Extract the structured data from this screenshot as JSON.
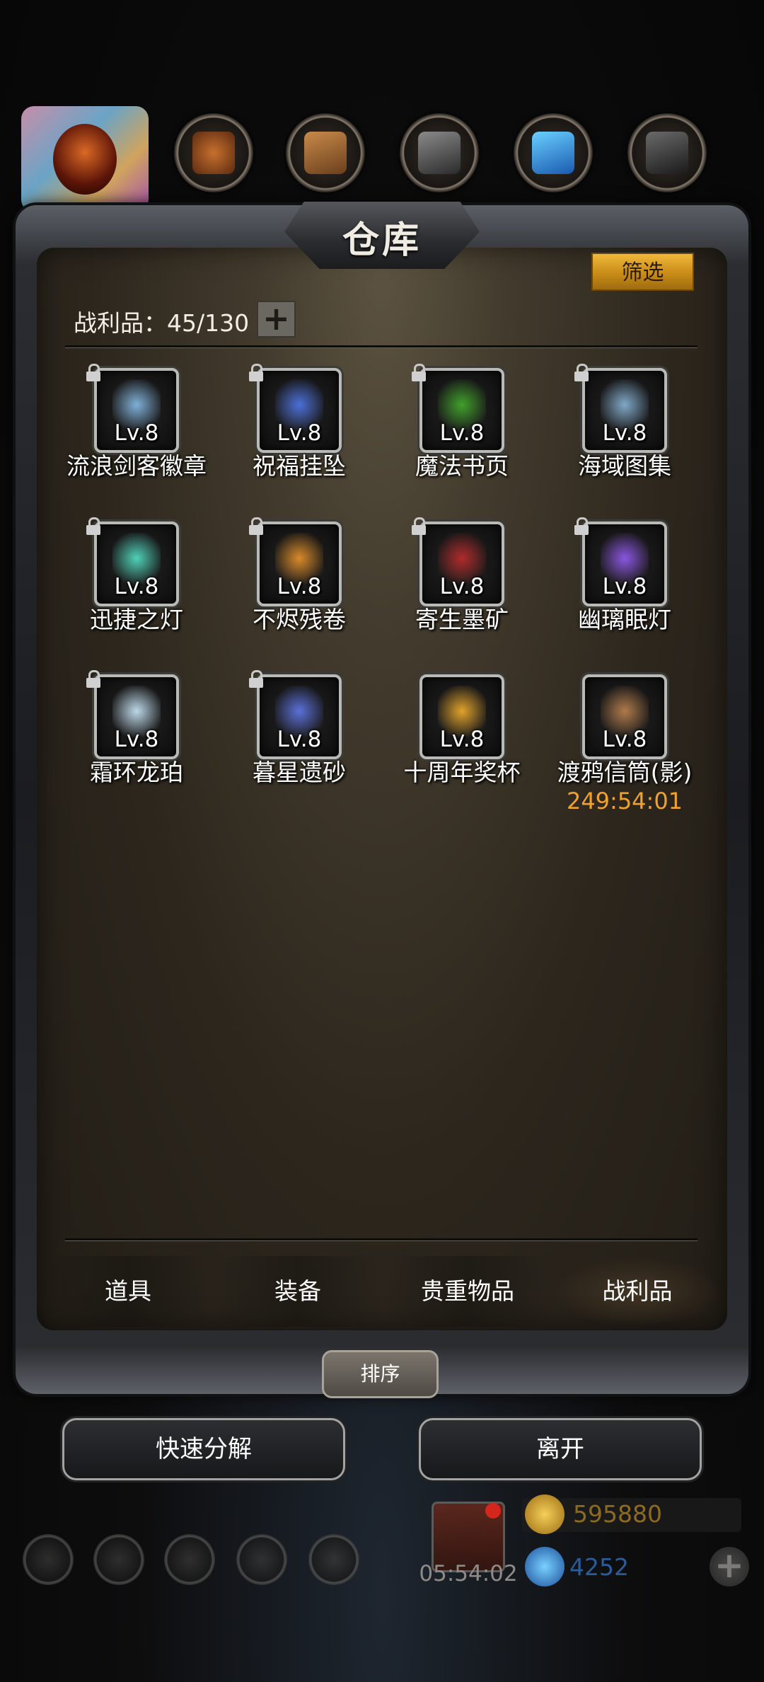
{
  "title": "仓库",
  "filter_label": "筛选",
  "capacity": {
    "label": "战利品：45/130",
    "add_symbol": "+"
  },
  "items": [
    {
      "name": "流浪剑客徽章",
      "level": "Lv.8",
      "locked": true,
      "icon": "sword-badge-icon",
      "color": "#7fb0d8"
    },
    {
      "name": "祝福挂坠",
      "level": "Lv.8",
      "locked": true,
      "icon": "pendant-icon",
      "color": "#4b6fd8"
    },
    {
      "name": "魔法书页",
      "level": "Lv.8",
      "locked": true,
      "icon": "green-page-icon",
      "color": "#3fa02a"
    },
    {
      "name": "海域图集",
      "level": "Lv.8",
      "locked": true,
      "icon": "blue-book-icon",
      "color": "#7fa8c8"
    },
    {
      "name": "迅捷之灯",
      "level": "Lv.8",
      "locked": true,
      "icon": "lantern-icon",
      "color": "#4fd0b8"
    },
    {
      "name": "不烬残卷",
      "level": "Lv.8",
      "locked": true,
      "icon": "scroll-icon",
      "color": "#d98a28"
    },
    {
      "name": "寄生墨矿",
      "level": "Lv.8",
      "locked": true,
      "icon": "dark-ore-icon",
      "color": "#b02a2a"
    },
    {
      "name": "幽璃眠灯",
      "level": "Lv.8",
      "locked": true,
      "icon": "purple-lamp-icon",
      "color": "#8a55e0"
    },
    {
      "name": "霜环龙珀",
      "level": "Lv.8",
      "locked": true,
      "icon": "frost-ring-icon",
      "color": "#bcd8e8"
    },
    {
      "name": "暮星遗砂",
      "level": "Lv.8",
      "locked": true,
      "icon": "sand-bottle-icon",
      "color": "#5a6fd8"
    },
    {
      "name": "十周年奖杯",
      "level": "Lv.8",
      "locked": false,
      "icon": "trophy-icon",
      "color": "#e0a22a"
    },
    {
      "name": "渡鸦信筒(影)",
      "level": "Lv.8",
      "locked": false,
      "icon": "letter-tube-icon",
      "color": "#b07a4a",
      "timer": "249:54:01"
    }
  ],
  "tabs": [
    {
      "label": "道具",
      "active": false
    },
    {
      "label": "装备",
      "active": false
    },
    {
      "label": "贵重物品",
      "active": false
    },
    {
      "label": "战利品",
      "active": true
    }
  ],
  "sort_label": "排序",
  "actions": {
    "decompose": "快速分解",
    "leave": "离开"
  },
  "hud": {
    "gift_timer": "05:54:02",
    "gold": "595880",
    "gems": "4252",
    "add_symbol": "+"
  }
}
